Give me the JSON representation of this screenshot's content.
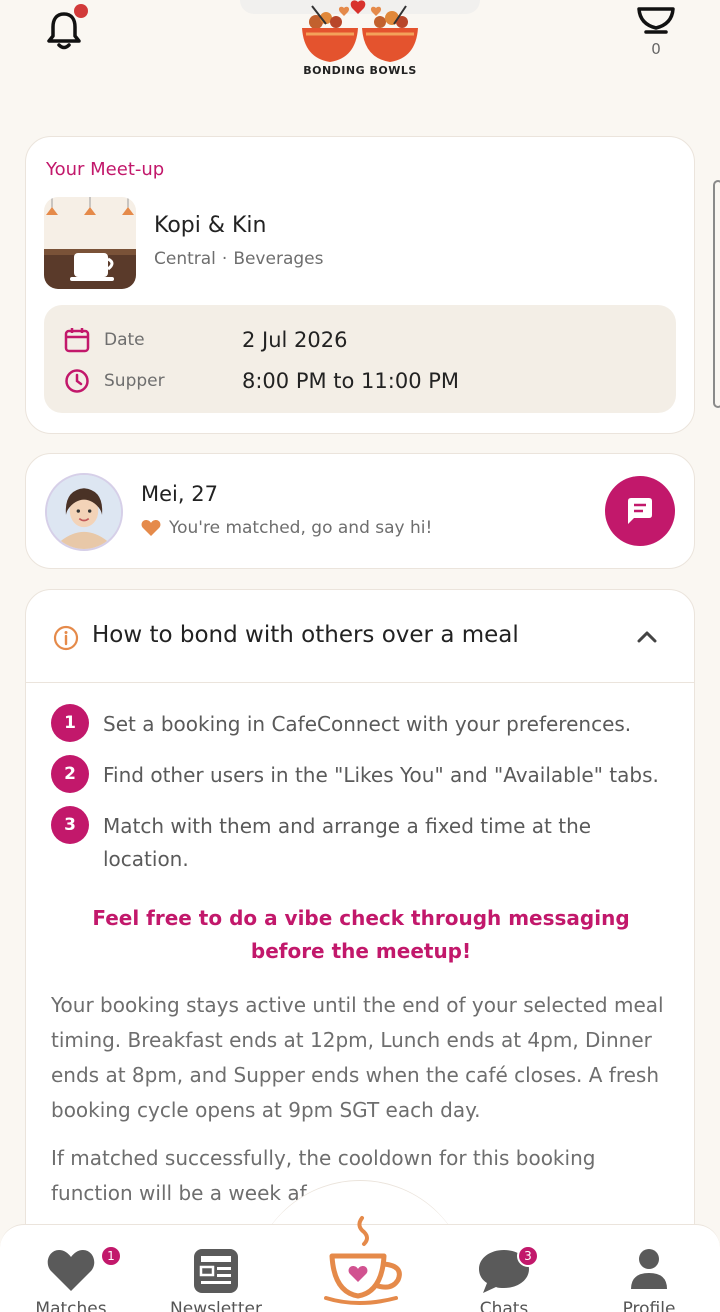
{
  "header": {
    "logo_text": "BONDING BOWLS",
    "bowl_count": "0"
  },
  "meetup": {
    "heading": "Your Meet-up",
    "cafe_name": "Kopi & Kin",
    "region": "Central",
    "separator": "·",
    "category": "Beverages",
    "date_label": "Date",
    "date_value": "2 Jul 2026",
    "meal_label": "Supper",
    "time_value": "8:00 PM to 11:00 PM"
  },
  "match": {
    "name": "Mei, 27",
    "status": "You're matched, go and say hi!"
  },
  "howto": {
    "title": "How to bond with others over a meal",
    "steps": [
      {
        "num": "1",
        "text": "Set a booking in CafeConnect with your preferences."
      },
      {
        "num": "2",
        "text": "Find other users in the \"Likes You\" and \"Available\" tabs."
      },
      {
        "num": "3",
        "text": "Match with them and arrange a fixed time at the location."
      }
    ],
    "vibe_note": "Feel free to do a vibe check through messaging before the meetup!",
    "para1": "Your booking stays active until the end of your selected meal timing. Breakfast ends at 12pm, Lunch ends at 4pm, Dinner ends at 8pm, and Supper ends when the café closes. A fresh booking cycle opens at 9pm SGT each day.",
    "para2": "If matched successfully, the cooldown for this booking function will be a week af"
  },
  "nav": {
    "matches_label": "Matches",
    "matches_badge": "1",
    "newsletter_label": "Newsletter",
    "chats_label": "Chats",
    "chats_badge": "3",
    "profile_label": "Profile"
  },
  "colors": {
    "accent": "#c2186b",
    "background": "#faf7f2",
    "detail_bg": "#f3eee6",
    "icon_pink": "#c2186b",
    "heart_orange": "#e58a4a"
  },
  "icons": {
    "bell": "bell-icon",
    "bowl": "bowl-icon",
    "calendar": "calendar-icon",
    "clock": "clock-icon",
    "chat": "chat-icon",
    "info": "info-icon",
    "chevron": "chevron-up-icon",
    "heart": "heart-icon",
    "newsletter": "newsletter-icon",
    "profile": "profile-icon",
    "cafe": "coffee-cup-icon"
  }
}
